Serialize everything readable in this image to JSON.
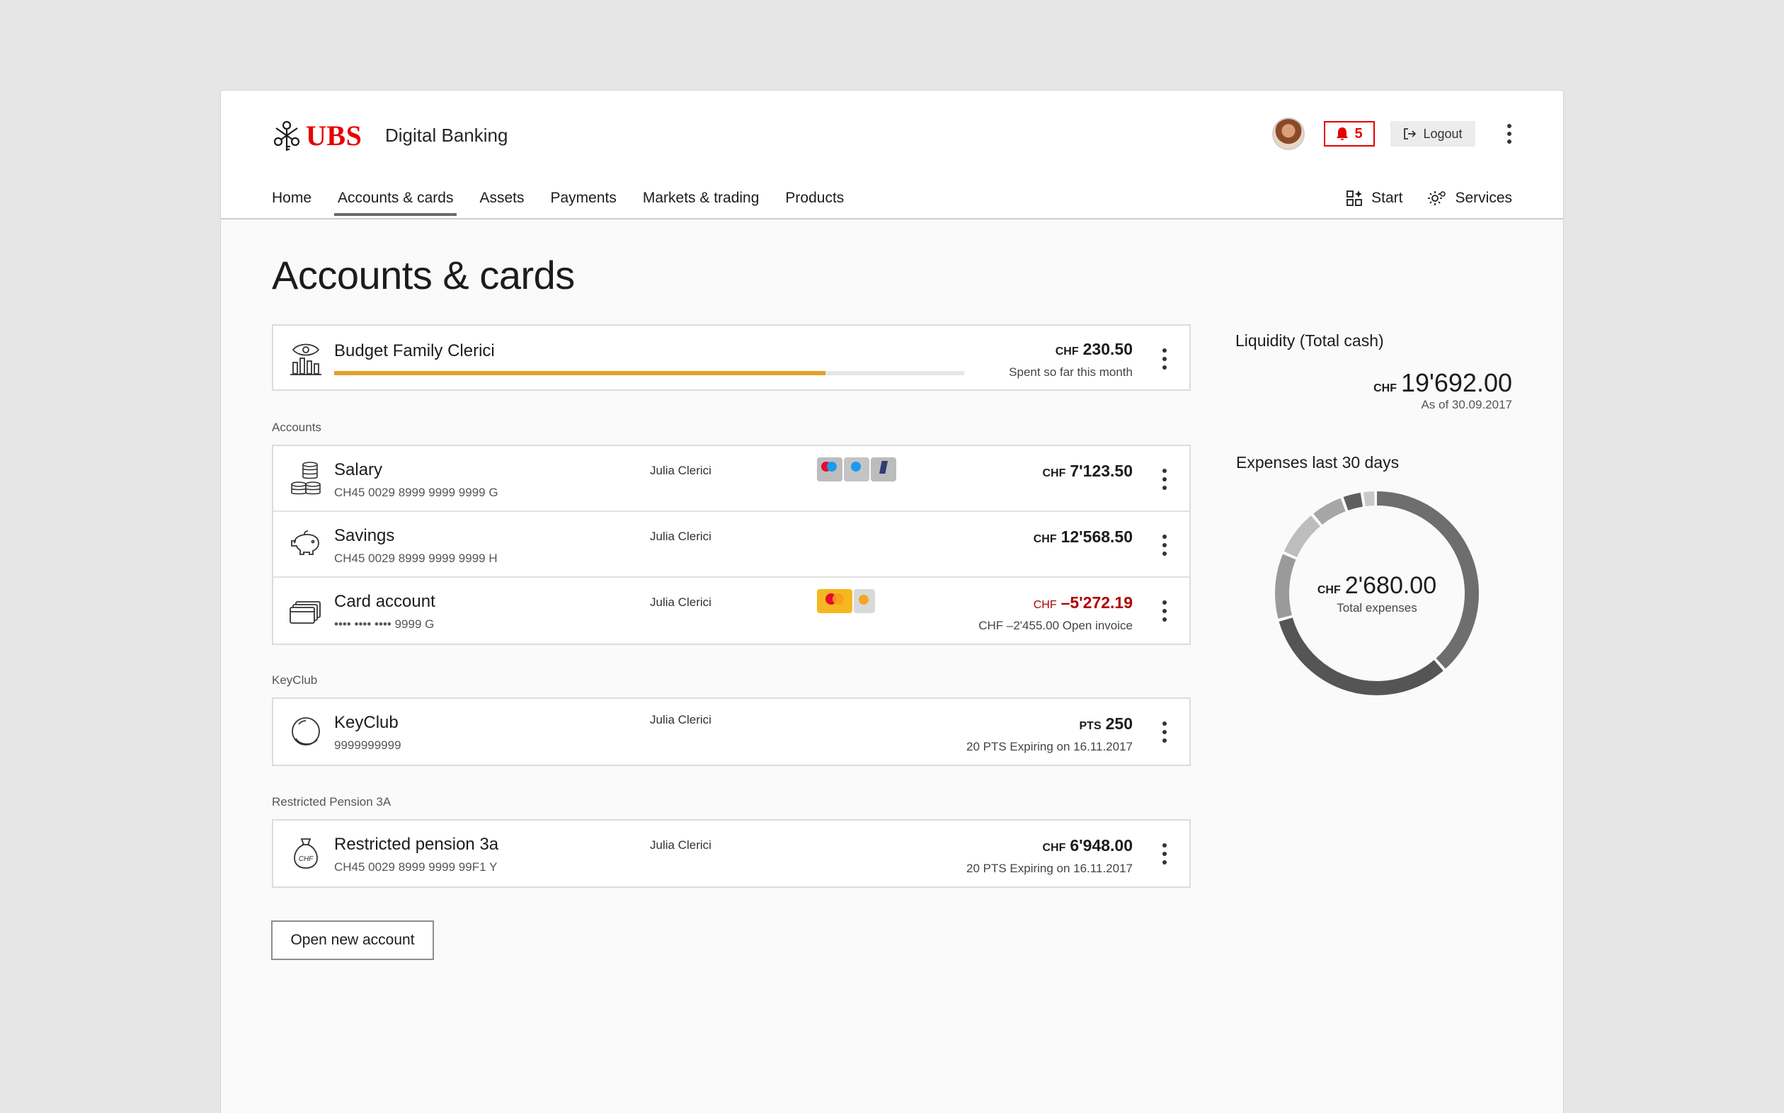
{
  "header": {
    "brand": "UBS",
    "app_name": "Digital Banking",
    "notification_count": "5",
    "logout_label": "Logout"
  },
  "nav": {
    "items": [
      "Home",
      "Accounts & cards",
      "Assets",
      "Payments",
      "Markets & trading",
      "Products"
    ],
    "active": "Accounts & cards",
    "right": [
      "Start",
      "Services"
    ]
  },
  "page": {
    "title": "Accounts & cards"
  },
  "budget": {
    "name": "Budget Family Clerici",
    "currency": "CHF",
    "amount": "230.50",
    "note": "Spent so far this month",
    "progress": 0.78,
    "bar_color": "#e5a02a"
  },
  "sections": {
    "accounts": "Accounts",
    "keyclub": "KeyClub",
    "pension": "Restricted Pension 3A"
  },
  "accounts": [
    {
      "name": "Salary",
      "number": "CH45 0029 8999 9999 9999 G",
      "owner": "Julia Clerici",
      "currency": "CHF",
      "amount": "7'123.50",
      "note": ""
    },
    {
      "name": "Savings",
      "number": "CH45 0029 8999 9999 9999 H",
      "owner": "Julia Clerici",
      "currency": "CHF",
      "amount": "12'568.50",
      "note": ""
    },
    {
      "name": "Card account",
      "number": "•••• •••• •••• 9999 G",
      "owner": "Julia Clerici",
      "currency": "CHF",
      "amount": "–5'272.19",
      "note": "CHF –2'455.00 Open invoice"
    }
  ],
  "keyclub": {
    "name": "KeyClub",
    "number": "9999999999",
    "owner": "Julia Clerici",
    "currency": "PTS",
    "amount": "250",
    "note": "20 PTS Expiring on 16.11.2017"
  },
  "pension": {
    "name": "Restricted pension 3a",
    "number": "CH45 0029 8999 9999 99F1 Y",
    "owner": "Julia Clerici",
    "currency": "CHF",
    "amount": "6'948.00",
    "note": "20 PTS Expiring on 16.11.2017",
    "icon_text": "CHF"
  },
  "actions": {
    "open_account": "Open new account"
  },
  "liquidity": {
    "title": "Liquidity (Total cash)",
    "currency": "CHF",
    "amount": "19'692.00",
    "as_of": "As of 30.09.2017"
  },
  "expenses": {
    "title": "Expenses last 30 days",
    "currency": "CHF",
    "amount": "2'680.00",
    "label": "Total expenses"
  },
  "chart_data": {
    "type": "pie",
    "donut": true,
    "values": [
      36,
      30,
      10,
      7,
      5,
      3,
      2
    ],
    "colors": [
      "#6e6e6e",
      "#555555",
      "#9a9a9a",
      "#bdbdbd",
      "#a6a6a6",
      "#5f5f5f",
      "#c8c8c8"
    ]
  }
}
